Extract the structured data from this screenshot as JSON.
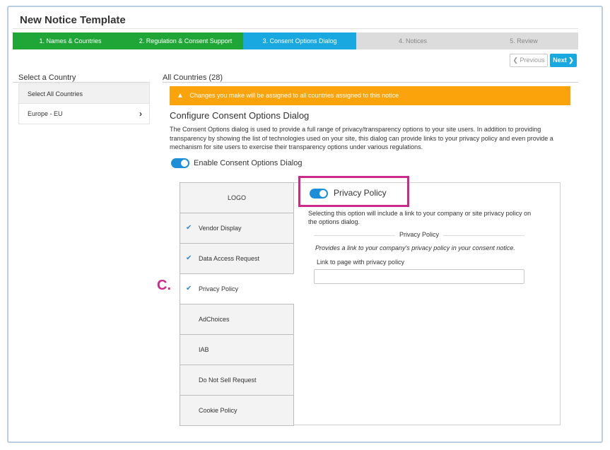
{
  "page_title": "New Notice Template",
  "wizard": {
    "steps": [
      {
        "label": "1. Names & Countries",
        "state": "done"
      },
      {
        "label": "2. Regulation & Consent Support",
        "state": "done"
      },
      {
        "label": "3. Consent Options Dialog",
        "state": "active"
      },
      {
        "label": "4. Notices",
        "state": "todo"
      },
      {
        "label": "5. Review",
        "state": "todo"
      }
    ],
    "previous_label": "Previous",
    "next_label": "Next"
  },
  "left": {
    "title": "Select a Country",
    "select_all_label": "Select All Countries",
    "items": [
      {
        "label": "Europe - EU"
      }
    ]
  },
  "right": {
    "title": "All Countries (28)",
    "warning": "Changes you make will be assigned to all countries assigned to this notice",
    "section_title": "Configure Consent Options Dialog",
    "description": "The Consent Options dialog is used to provide a full range of privacy/transparency options to your site users. In addition to providing transparency by showing the list of technologies used on your site, this dialog can provide links to your privacy policy and even provide a mechanism for site users to exercise their transparency options under various regulations.",
    "enable_label": "Enable Consent Options Dialog",
    "enable_on": true
  },
  "tabs": [
    {
      "label": "LOGO",
      "checked": false
    },
    {
      "label": "Vendor Display",
      "checked": true
    },
    {
      "label": "Data Access Request",
      "checked": true
    },
    {
      "label": "Privacy Policy",
      "checked": true,
      "active": true
    },
    {
      "label": "AdChoices",
      "checked": false
    },
    {
      "label": "IAB",
      "checked": false
    },
    {
      "label": "Do Not Sell Request",
      "checked": false
    },
    {
      "label": "Cookie Policy",
      "checked": false
    }
  ],
  "privacy_policy": {
    "toggle_label": "Privacy Policy",
    "toggle_on": true,
    "description": "Selecting this option will include a link to your company or site privacy policy on the options dialog.",
    "subhead": "Privacy Policy",
    "italic_note": "Provides a link to your company's privacy policy in your consent notice.",
    "link_label": "Link to page with privacy policy",
    "link_value": ""
  },
  "annotation": {
    "label": "C."
  },
  "colors": {
    "step_done": "#1fa637",
    "step_active": "#19a8e0",
    "step_todo": "#dcdcdc",
    "warning": "#fba30a",
    "toggle_on": "#1d8ed8",
    "highlight": "#cc2a8a",
    "check": "#2a88cf"
  },
  "icons": {
    "warning": "warning-triangle-icon",
    "prev": "chevron-left-icon",
    "next": "chevron-right-icon",
    "country": "chevron-right-icon",
    "check": "check-icon"
  }
}
